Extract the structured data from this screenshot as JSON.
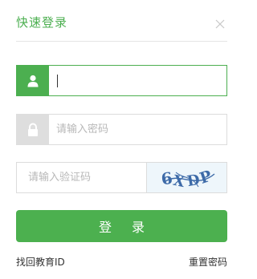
{
  "dialog": {
    "title": "快速登录",
    "close_icon": "close-icon"
  },
  "username": {
    "icon": "user-icon",
    "value": "",
    "placeholder": ""
  },
  "password": {
    "icon": "lock-icon",
    "placeholder": "请输入密码"
  },
  "captcha": {
    "placeholder": "请输入验证码",
    "image_text": "6XDP"
  },
  "login_button": {
    "label": "登 录"
  },
  "links": {
    "recover_id": "找回教育ID",
    "reset_password": "重置密码"
  },
  "colors": {
    "accent": "#4caf50",
    "border": "#dcdcdc",
    "placeholder": "#b8b8b8"
  }
}
